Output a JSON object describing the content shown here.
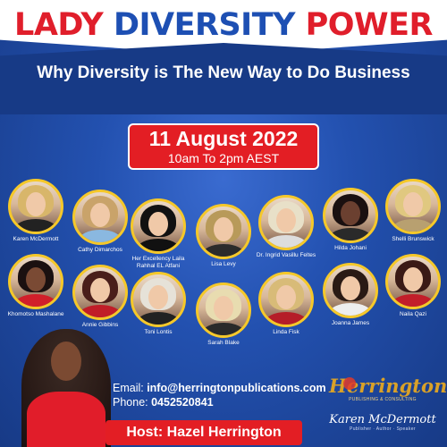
{
  "title": {
    "part1": "LADY ",
    "part2": "DIVERSITY ",
    "part3": "POWER"
  },
  "subtitle": "Why Diversity is The New Way to Do Business",
  "event": {
    "date": "11 August 2022",
    "time": "10am To 2pm AEST"
  },
  "speakers": [
    {
      "name": "Karen McDermott"
    },
    {
      "name": "Cathy Dimarchos"
    },
    {
      "name": "Her Excellency Laila Rahhal EL Atfani"
    },
    {
      "name": "Lisa Levy"
    },
    {
      "name": "Dr. Ingrid Vasillu Feltes"
    },
    {
      "name": "Hilda Johani"
    },
    {
      "name": "Shelli Brunswick"
    },
    {
      "name": "Khomotso Mashalane"
    },
    {
      "name": "Annie Gibbins"
    },
    {
      "name": "Toni Lontis"
    },
    {
      "name": "Sarah Blake"
    },
    {
      "name": "Linda Fisk"
    },
    {
      "name": "Joanna James"
    },
    {
      "name": "Naila Qazi"
    }
  ],
  "contact": {
    "email_label": "Email: ",
    "email": "info@herringtonpublications.com",
    "phone_label": "Phone: ",
    "phone": "0452520841"
  },
  "host": "Host: Hazel Herrington",
  "logo": {
    "brand": "Herrington",
    "sub": "PUBLISHING & CONSULTING",
    "signature": "Karen McDermott",
    "tagline": "Publisher · Author · Speaker"
  },
  "colors": {
    "accent_red": "#e31e24",
    "title_blue": "#1d4fb3",
    "photo_ring": "#f5c82a",
    "background": "#2351b0"
  }
}
